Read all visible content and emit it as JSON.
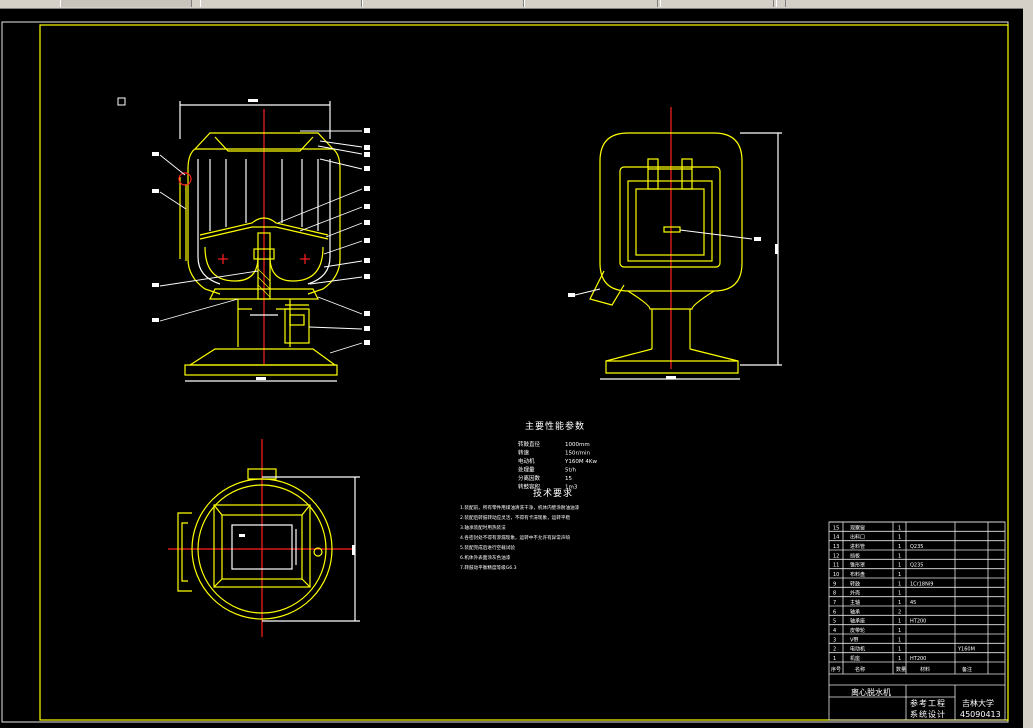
{
  "window": {
    "toolbar_segments": 6
  },
  "drawing": {
    "title_block": {
      "product_name": "离心脱水机",
      "label_1": "参考工程",
      "label_2": "系统设计",
      "school": "吉林大学",
      "drawing_number": "45090413"
    },
    "notes": {
      "params_title": "主要性能参数",
      "params": [
        {
          "name": "转鼓直径",
          "value": "1000mm"
        },
        {
          "name": "转速",
          "value": "150r/min"
        },
        {
          "name": "电动机",
          "value": "Y160M 4Kw"
        },
        {
          "name": "处理量",
          "value": "5t/h"
        },
        {
          "name": "分离因数",
          "value": "15"
        },
        {
          "name": "转鼓容积",
          "value": "1m3"
        }
      ],
      "req_title": "技术要求",
      "requirements": [
        "1.装配前，所有零件用煤油清洗干净，机体内壁涂耐油油漆",
        "2.装配后转鼓转动应灵活，不得有卡滞现象，运转平稳",
        "3.轴承装配时用热装法",
        "4.各密封处不得有渗漏现象，运转中不允许有异常声响",
        "5.装配完成后进行空载试验",
        "6.机体外表面涂灰色油漆",
        "7.转鼓动平衡精度等级G6.3"
      ]
    },
    "bom_rows": [
      {
        "no": "15",
        "name": "观察窗",
        "qty": "1",
        "mat": "",
        "note": ""
      },
      {
        "no": "14",
        "name": "出料口",
        "qty": "1",
        "mat": "",
        "note": ""
      },
      {
        "no": "13",
        "name": "进料管",
        "qty": "1",
        "mat": "Q235",
        "note": ""
      },
      {
        "no": "12",
        "name": "挡板",
        "qty": "1",
        "mat": "",
        "note": ""
      },
      {
        "no": "11",
        "name": "锥形罩",
        "qty": "1",
        "mat": "Q235",
        "note": ""
      },
      {
        "no": "10",
        "name": "布料盘",
        "qty": "1",
        "mat": "",
        "note": ""
      },
      {
        "no": "9",
        "name": "转鼓",
        "qty": "1",
        "mat": "1Cr18Ni9",
        "note": ""
      },
      {
        "no": "8",
        "name": "外壳",
        "qty": "1",
        "mat": "",
        "note": ""
      },
      {
        "no": "7",
        "name": "主轴",
        "qty": "1",
        "mat": "45",
        "note": ""
      },
      {
        "no": "6",
        "name": "轴承",
        "qty": "2",
        "mat": "",
        "note": ""
      },
      {
        "no": "5",
        "name": "轴承座",
        "qty": "1",
        "mat": "HT200",
        "note": ""
      },
      {
        "no": "4",
        "name": "皮带轮",
        "qty": "1",
        "mat": "",
        "note": ""
      },
      {
        "no": "3",
        "name": "V带",
        "qty": "1",
        "mat": "",
        "note": ""
      },
      {
        "no": "2",
        "name": "电动机",
        "qty": "1",
        "mat": "",
        "note": "Y160M"
      },
      {
        "no": "1",
        "name": "机座",
        "qty": "1",
        "mat": "HT200",
        "note": ""
      }
    ],
    "bom_header": {
      "no": "序号",
      "name": "名称",
      "qty": "数量",
      "mat": "材料",
      "note": "备注"
    }
  }
}
